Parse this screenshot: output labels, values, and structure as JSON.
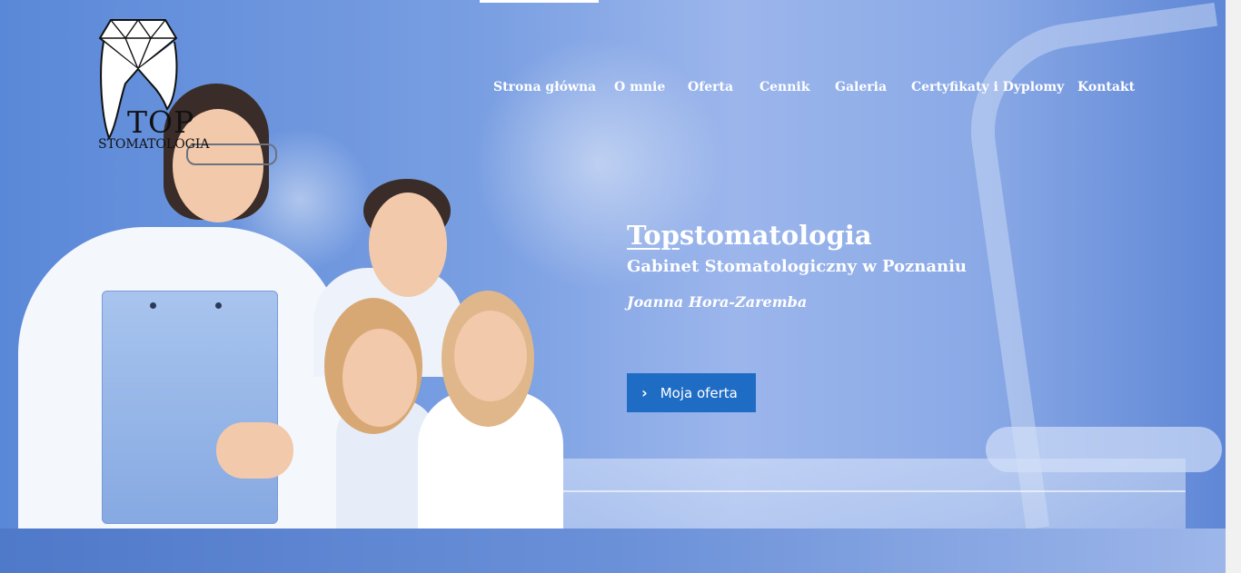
{
  "logo": {
    "top": "TOP",
    "bottom": "STOMATOLOGIA"
  },
  "nav": {
    "items": [
      {
        "label": "Strona główna"
      },
      {
        "label": "O mnie"
      },
      {
        "label": "Oferta"
      },
      {
        "label": "Cennik"
      },
      {
        "label": "Galeria"
      },
      {
        "label": "Certyfikaty i Dyplomy"
      },
      {
        "label": "Kontakt"
      }
    ]
  },
  "hero": {
    "title_underlined": "Top",
    "title_rest": "stomatologia",
    "subtitle": "Gabinet Stomatologiczny w Poznaniu",
    "author": "Joanna Hora-Zaremba",
    "cta_label": "Moja oferta",
    "cta_icon": "chevron-right-icon"
  },
  "colors": {
    "background": "#7a9fe2",
    "cta": "#1f6cc4",
    "text": "#ffffff"
  }
}
